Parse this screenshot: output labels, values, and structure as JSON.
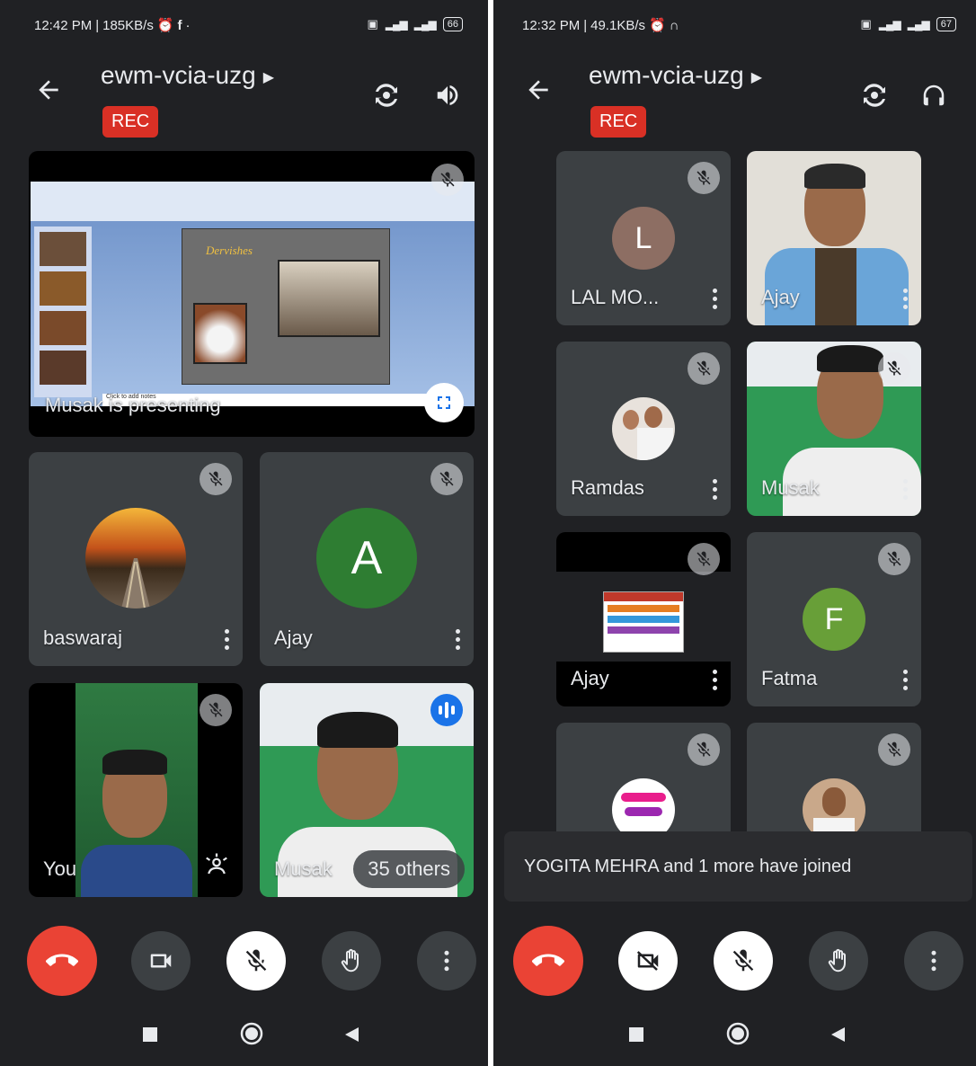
{
  "left": {
    "status": {
      "time": "12:42 PM",
      "speed": "185KB/s",
      "battery": "66"
    },
    "meeting_code": "ewm-vcia-uzg",
    "rec_label": "REC",
    "presentation": {
      "caption": "Musak is presenting",
      "slide_title": "Dervishes",
      "slide_footer": "Click to add notes"
    },
    "tiles": [
      {
        "name": "baswaraj"
      },
      {
        "name": "Ajay",
        "initial": "A",
        "color": "#2e7d32"
      },
      {
        "name": "You"
      },
      {
        "name": "Musak",
        "others": "35 others"
      }
    ]
  },
  "right": {
    "status": {
      "time": "12:32 PM",
      "speed": "49.1KB/s",
      "battery": "67"
    },
    "meeting_code": "ewm-vcia-uzg",
    "rec_label": "REC",
    "tiles": [
      {
        "name": "LAL MO...",
        "initial": "L",
        "color": "#8d6e63"
      },
      {
        "name": "Ajay"
      },
      {
        "name": "Ramdas"
      },
      {
        "name": "Musak"
      },
      {
        "name": "Ajay"
      },
      {
        "name": "Fatma",
        "initial": "F",
        "color": "#689f38"
      }
    ],
    "toast": "YOGITA MEHRA and 1 more have joined"
  },
  "icons": [
    "back-arrow-icon",
    "switch-camera-icon",
    "speaker-icon",
    "headphones-icon",
    "mic-off-icon",
    "end-call-icon",
    "camera-icon",
    "camera-off-icon",
    "raise-hand-icon",
    "more-vert-icon",
    "fullscreen-icon",
    "audio-level-icon",
    "nav-recents-icon",
    "nav-home-icon",
    "nav-back-icon"
  ],
  "colors": {
    "background": "#202124",
    "tile": "#3c4043",
    "rec": "#d93025",
    "end_call": "#ea4335"
  }
}
